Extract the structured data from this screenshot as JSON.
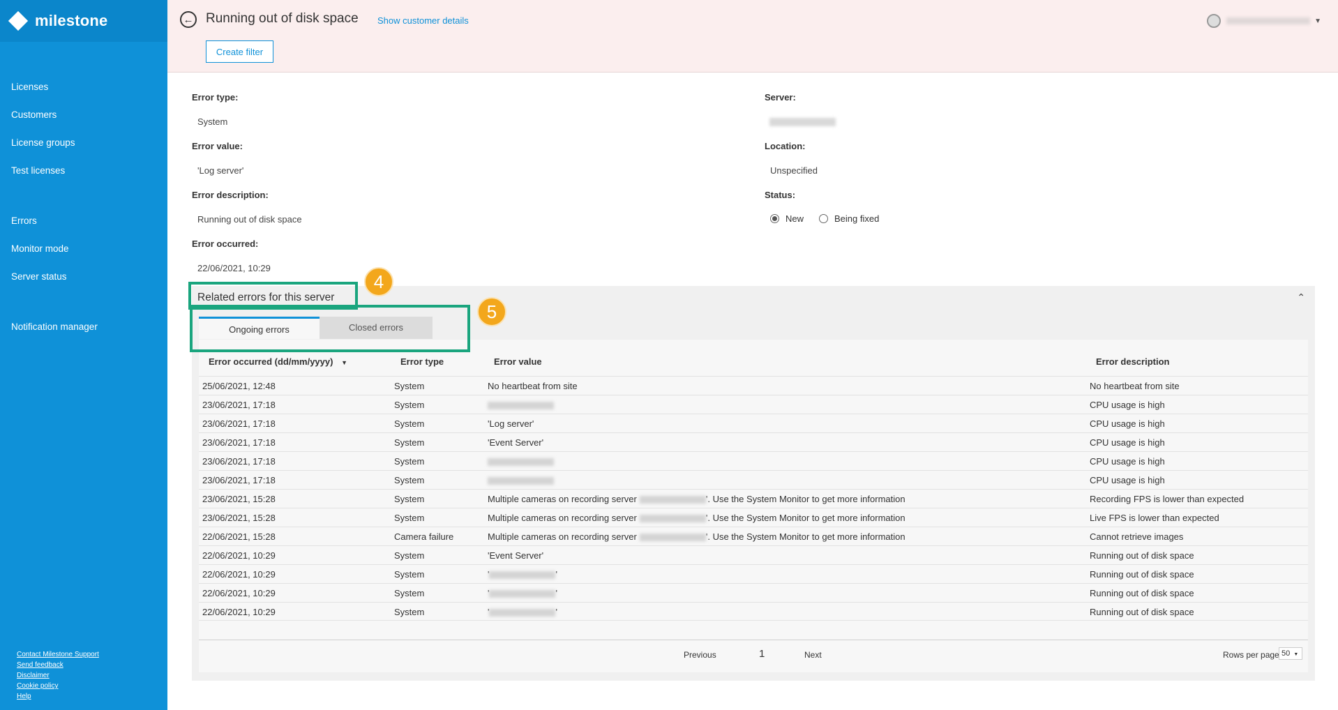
{
  "brand": {
    "logo_text": "milestone"
  },
  "sidebar": {
    "group1": [
      "Licenses",
      "Customers",
      "License groups",
      "Test licenses"
    ],
    "group2": [
      "Errors",
      "Monitor mode",
      "Server status"
    ],
    "group3": [
      "Notification manager"
    ],
    "footer": [
      "Contact Milestone Support",
      "Send feedback",
      "Disclaimer",
      "Cookie policy",
      "Help"
    ]
  },
  "header": {
    "title": "Running out of disk space",
    "show_customer": "Show customer details",
    "create_filter": "Create filter"
  },
  "details": {
    "error_type_label": "Error type:",
    "error_type_value": "System",
    "error_value_label": "Error value:",
    "error_value_value": "'Log server'",
    "error_description_label": "Error description:",
    "error_description_value": "Running out of disk space",
    "error_occurred_label": "Error occurred:",
    "error_occurred_value": "22/06/2021, 10:29",
    "server_label": "Server:",
    "location_label": "Location:",
    "location_value": "Unspecified",
    "status_label": "Status:",
    "status_options": [
      "New",
      "Being fixed"
    ],
    "status_selected": "New"
  },
  "related": {
    "title": "Related errors for this server",
    "tabs": [
      "Ongoing errors",
      "Closed errors"
    ],
    "active_tab": "Ongoing errors",
    "columns": [
      "Error occurred (dd/mm/yyyy)",
      "Error type",
      "Error value",
      "Error description"
    ],
    "rows": [
      {
        "occurred": "25/06/2021, 12:48",
        "type": "System",
        "value": "No heartbeat from site",
        "description": "No heartbeat from site"
      },
      {
        "occurred": "23/06/2021, 17:18",
        "type": "System",
        "value_blurred": true,
        "description": "CPU usage is high"
      },
      {
        "occurred": "23/06/2021, 17:18",
        "type": "System",
        "value": "'Log server'",
        "description": "CPU usage is high"
      },
      {
        "occurred": "23/06/2021, 17:18",
        "type": "System",
        "value": "'Event Server'",
        "description": "CPU usage is high"
      },
      {
        "occurred": "23/06/2021, 17:18",
        "type": "System",
        "value_blurred": true,
        "description": "CPU usage is high"
      },
      {
        "occurred": "23/06/2021, 17:18",
        "type": "System",
        "value_blurred": true,
        "description": "CPU usage is high"
      },
      {
        "occurred": "23/06/2021, 15:28",
        "type": "System",
        "value_prefix": "Multiple cameras on recording server",
        "value_suffix": "'. Use the System Monitor to get more information",
        "description": "Recording FPS is lower than expected"
      },
      {
        "occurred": "23/06/2021, 15:28",
        "type": "System",
        "value_prefix": "Multiple cameras on recording server",
        "value_suffix": "'. Use the System Monitor to get more information",
        "description": "Live FPS is lower than expected"
      },
      {
        "occurred": "22/06/2021, 15:28",
        "type": "Camera failure",
        "value_prefix": "Multiple cameras on recording server",
        "value_suffix": "'. Use the System Monitor to get more information",
        "description": "Cannot retrieve images"
      },
      {
        "occurred": "22/06/2021, 10:29",
        "type": "System",
        "value": "'Event Server'",
        "description": "Running out of disk space"
      },
      {
        "occurred": "22/06/2021, 10:29",
        "type": "System",
        "value_prefix": "'",
        "value_suffix": "'",
        "description": "Running out of disk space"
      },
      {
        "occurred": "22/06/2021, 10:29",
        "type": "System",
        "value_prefix": "'",
        "value_suffix": "'",
        "description": "Running out of disk space"
      },
      {
        "occurred": "22/06/2021, 10:29",
        "type": "System",
        "value_prefix": "'",
        "value_suffix": "'",
        "description": "Running out of disk space"
      }
    ],
    "pagination": {
      "previous": "Previous",
      "page": "1",
      "next": "Next",
      "rows_per_page_label": "Rows per page",
      "rows_per_page": "50"
    }
  },
  "callouts": {
    "four": "4",
    "five": "5"
  },
  "colors": {
    "sidebar": "#0f91d8",
    "accent": "#0f91d8",
    "header_bg": "#fbeeee",
    "callout_box": "#1aa57e",
    "callout_badge": "#f3a71c"
  }
}
